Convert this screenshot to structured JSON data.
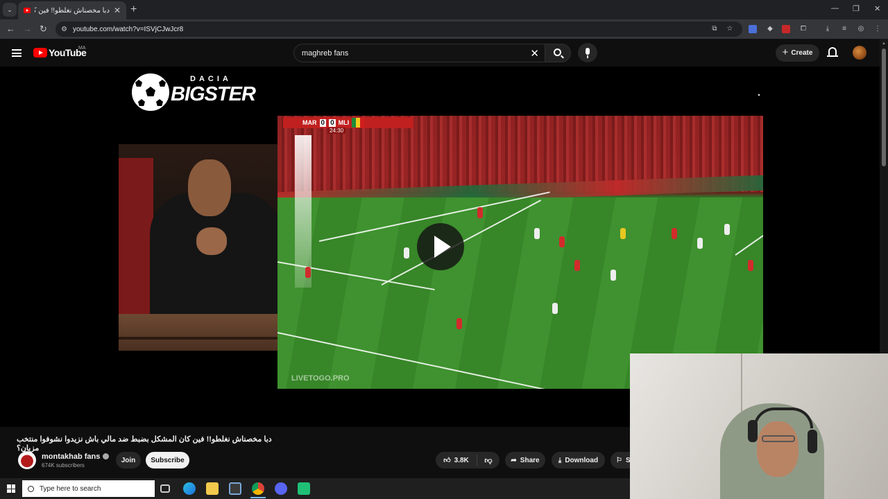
{
  "browser": {
    "tab_title": "دبا مخصناش نغلطو!! فين كا...",
    "new_tab": "+",
    "url": "youtube.com/watch?v=ISVjCJwJcr8"
  },
  "youtube": {
    "logo_text": "YouTube",
    "country_code": "MA",
    "search": {
      "value": "maghreb fans"
    },
    "create_label": "Create"
  },
  "video": {
    "brand_top": "DACIA",
    "brand_name": "BIGSTER",
    "match": {
      "home": "MAR",
      "away": "MLI",
      "home_score": "0",
      "away_score": "0",
      "clock": "24:30"
    },
    "watermark": "LIVETOGO.PRO"
  },
  "info": {
    "title": "دبا مخصناش نغلطو!! فين كان المشكل بضبط ضد مالي باش نزيدوا نشوفوا منتخب مزيان؟",
    "channel": "montakhab fans",
    "subscribers": "674K subscribers",
    "join_label": "Join",
    "subscribe_label": "Subscribe",
    "likes": "3.8K",
    "share_label": "Share",
    "download_label": "Download",
    "save_label": "S"
  },
  "taskbar": {
    "search_placeholder": "Type here to search"
  },
  "colors": {
    "yt_red": "#ff0000",
    "bg": "#0f0f0f",
    "morocco_red": "#c0201f"
  }
}
